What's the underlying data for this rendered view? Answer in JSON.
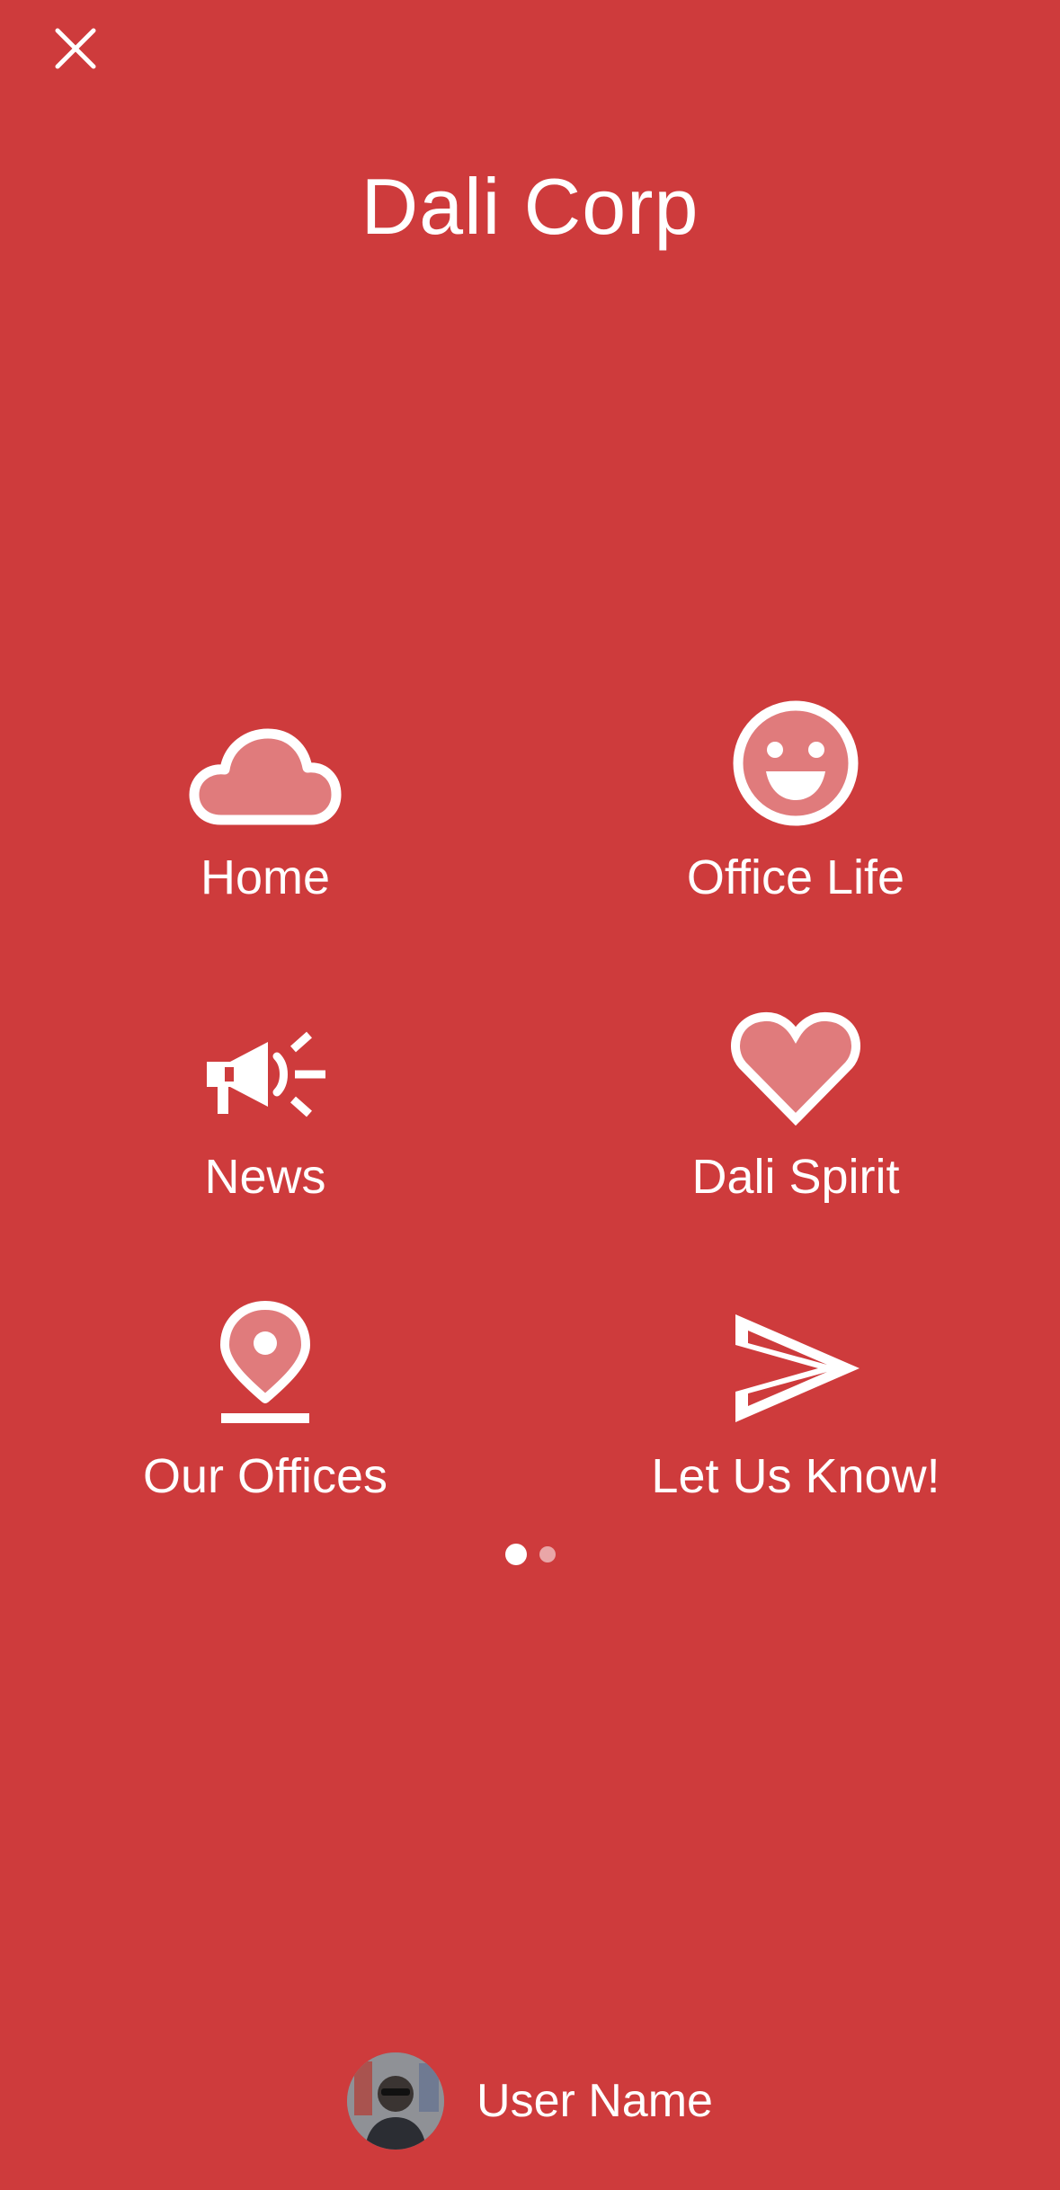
{
  "colors": {
    "background": "#ce3b3c",
    "foreground": "#ffffff",
    "icon_fill": "#e07b7c"
  },
  "header": {
    "close_icon": "close-icon",
    "title": "Dali Corp"
  },
  "menu": {
    "items": [
      {
        "label": "Home",
        "icon": "cloud-icon"
      },
      {
        "label": "Office Life",
        "icon": "smiley-icon"
      },
      {
        "label": "News",
        "icon": "megaphone-icon"
      },
      {
        "label": "Dali Spirit",
        "icon": "heart-icon"
      },
      {
        "label": "Our Offices",
        "icon": "map-pin-icon"
      },
      {
        "label": "Let Us Know!",
        "icon": "paper-plane-icon"
      }
    ]
  },
  "pager": {
    "page_count": 2,
    "current_page": 1
  },
  "user": {
    "name": "User Name",
    "avatar_icon": "user-avatar"
  }
}
